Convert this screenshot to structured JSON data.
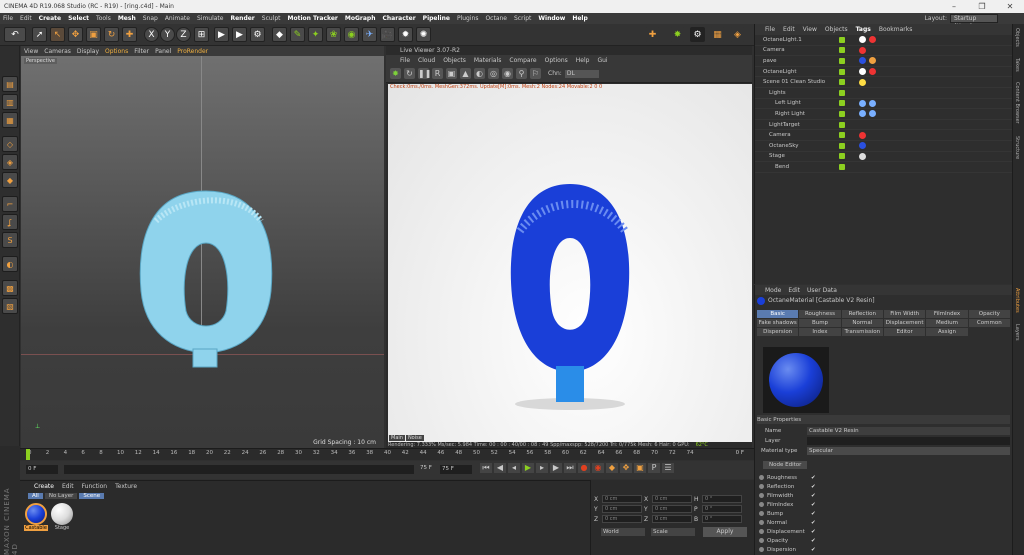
{
  "app": {
    "title": "CINEMA 4D R19.068 Studio (RC - R19) - [ring.c4d] - Main",
    "layout_label": "Layout:",
    "layout_value": "Startup (User)"
  },
  "menubar": [
    "File",
    "Edit",
    "Create",
    "Select",
    "Tools",
    "Mesh",
    "Snap",
    "Animate",
    "Simulate",
    "Render",
    "Sculpt",
    "Motion Tracker",
    "MoGraph",
    "Character",
    "Pipeline",
    "Plugins",
    "Octane",
    "Script",
    "Window",
    "Help"
  ],
  "menubar_bold": [
    "Create",
    "Select",
    "Mesh",
    "Render",
    "Motion Tracker",
    "MoGraph",
    "Character",
    "Pipeline",
    "Window",
    "Help"
  ],
  "viewport1": {
    "menu": [
      "View",
      "Cameras",
      "Display",
      "Options",
      "Filter",
      "Panel",
      "ProRender"
    ],
    "label": "Perspective",
    "grid_spacing": "Grid Spacing : 10 cm"
  },
  "liveviewer": {
    "title": "Live Viewer 3.07-R2",
    "menu": [
      "File",
      "Cloud",
      "Objects",
      "Materials",
      "Compare",
      "Options",
      "Help",
      "Gui"
    ],
    "chn_label": "Chn:",
    "chn_value": "DL",
    "stats": "Check:0ms./0ms. MeshGen:372ms. Update[M]:0ms. Mesh:2 Nodes:24 Movable:2  0 0",
    "tabs": [
      "Main",
      "Noise"
    ],
    "render_status": "Rendering: 7.333%   Ms/sec: 5.984   Time: 00 : 00 : 40/00 : 08 : 49   Spp/maxspp: 528/7200   Tri: 0/775k   Mesh: 6  Hair: 0   GPU:",
    "gpu_temp": "62°C"
  },
  "object_manager": {
    "menu": [
      "File",
      "Edit",
      "View",
      "Objects",
      "Tags",
      "Bookmarks"
    ],
    "objects": [
      {
        "name": "OctaneLight.1",
        "indent": 0
      },
      {
        "name": "Camera",
        "indent": 0
      },
      {
        "name": "pave",
        "indent": 0
      },
      {
        "name": "OctaneLight",
        "indent": 0
      },
      {
        "name": "Scene 01 Clean Studio",
        "indent": 0
      },
      {
        "name": "Lights",
        "indent": 1
      },
      {
        "name": "Left Light",
        "indent": 2
      },
      {
        "name": "Right Light",
        "indent": 2
      },
      {
        "name": "LightTarget",
        "indent": 1
      },
      {
        "name": "Camera",
        "indent": 1
      },
      {
        "name": "OctaneSky",
        "indent": 1
      },
      {
        "name": "Stage",
        "indent": 1
      },
      {
        "name": "Bend",
        "indent": 2
      }
    ]
  },
  "attributes": {
    "menu": [
      "Mode",
      "Edit",
      "User Data"
    ],
    "material": "OctaneMaterial [Castable V2 Resin]",
    "tabs": [
      "Basic",
      "Roughness",
      "Reflection",
      "Film Width",
      "FilmIndex",
      "Opacity",
      "Fake shadows",
      "Bump",
      "Normal",
      "Displacement",
      "Medium",
      "Common",
      "Dispersion",
      "Index",
      "Transmission",
      "Editor",
      "Assign"
    ],
    "section": "Basic Properties",
    "name_label": "Name",
    "name_value": "Castable V2 Resin",
    "layer_label": "Layer",
    "mattype_label": "Material type",
    "mattype_value": "Specular",
    "node_editor": "Node Editor",
    "channels": [
      "Roughness",
      "Reflection",
      "Filmwidth",
      "FilmIndex",
      "Bump",
      "Normal",
      "Displacement",
      "Opacity",
      "Dispersion"
    ]
  },
  "timeline": {
    "ticks": [
      "0",
      "2",
      "4",
      "6",
      "8",
      "10",
      "12",
      "14",
      "16",
      "18",
      "20",
      "22",
      "24",
      "26",
      "28",
      "30",
      "32",
      "34",
      "36",
      "38",
      "40",
      "42",
      "44",
      "46",
      "48",
      "50",
      "52",
      "54",
      "56",
      "58",
      "60",
      "62",
      "64",
      "66",
      "68",
      "70",
      "72",
      "74"
    ],
    "end": "0 F",
    "start_field": "0 F",
    "current": "0 F",
    "end_field": "75 F",
    "max_field": "75 F"
  },
  "material_manager": {
    "menu": [
      "Create",
      "Edit",
      "Function",
      "Texture"
    ],
    "filters": [
      "All",
      "No Layer",
      "Scene"
    ],
    "materials": [
      "Castable",
      "Stage"
    ]
  },
  "coordinates": {
    "rows": [
      {
        "a": "X",
        "av": "0 cm",
        "b": "X",
        "bv": "0 cm",
        "c": "H",
        "cv": "0 °"
      },
      {
        "a": "Y",
        "av": "0 cm",
        "b": "Y",
        "bv": "0 cm",
        "c": "P",
        "cv": "0 °"
      },
      {
        "a": "Z",
        "av": "0 cm",
        "b": "Z",
        "bv": "0 cm",
        "c": "B",
        "cv": "0 °"
      }
    ],
    "mode1": "World",
    "mode2": "Scale",
    "apply": "Apply"
  },
  "right_strip": [
    "Objects",
    "Takes",
    "Content Browser",
    "Structure",
    "Attributes",
    "Layers"
  ],
  "colors": {
    "accent": "#f0a040",
    "ring_preview": "#8fd3ec",
    "ring_render": "#1a3fd8",
    "check": "#8ccf20"
  }
}
